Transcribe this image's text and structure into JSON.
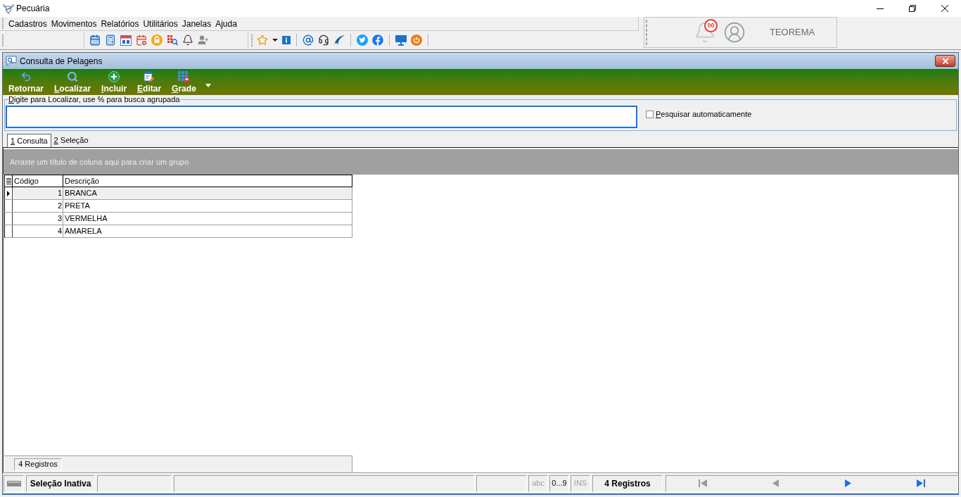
{
  "app": {
    "title": "Pecuária"
  },
  "menu": [
    "Cadastros",
    "Movimentos",
    "Relatórios",
    "Utilitários",
    "Janelas",
    "Ajuda"
  ],
  "user_panel": {
    "notification_count": "00",
    "user": "TEOREMA"
  },
  "form": {
    "title": "Consulta de Pelagens"
  },
  "actions": [
    {
      "label": "Retornar",
      "kind": "back",
      "mnemonic": false
    },
    {
      "label": "Localizar",
      "kind": "find",
      "mnemonic": true
    },
    {
      "label": "Incluir",
      "kind": "add",
      "mnemonic": true
    },
    {
      "label": "Editar",
      "kind": "edit",
      "mnemonic": true
    },
    {
      "label": "Grade",
      "kind": "grid",
      "mnemonic": true
    }
  ],
  "search": {
    "legend": "Digite para Localizar, use % para busca agrupada",
    "legend_mnemonic": true,
    "auto_search": {
      "label": "Pesquisar automaticamente",
      "checked": false,
      "mnemonic": true
    }
  },
  "tabs": [
    {
      "label": "1 Consulta",
      "selected": true,
      "mnemonic": true
    },
    {
      "label": "2 Seleção",
      "selected": false,
      "mnemonic": true
    }
  ],
  "group_panel": {
    "hint": "Arraste um título de coluna aqui para criar um grupo"
  },
  "grid": {
    "columns": [
      "Código",
      "Descrição"
    ],
    "rows": [
      {
        "cells": [
          "1",
          "BRANCA"
        ],
        "selected": true
      },
      {
        "cells": [
          "2",
          "PRETA"
        ],
        "selected": false
      },
      {
        "cells": [
          "3",
          "VERMELHA"
        ],
        "selected": false
      },
      {
        "cells": [
          "4",
          "AMARELA"
        ],
        "selected": false
      }
    ]
  },
  "grid_footer": {
    "count": "4 Registros"
  },
  "status_bar": {
    "selection": "Seleção Inativa",
    "indicators": [
      {
        "label": "abc",
        "active": false
      },
      {
        "label": "0...9",
        "active": true
      },
      {
        "label": "INS",
        "active": false
      }
    ],
    "records": "4 Registros",
    "navigation": [
      {
        "kind": "first",
        "disabled": true
      },
      {
        "kind": "previous",
        "disabled": true
      },
      {
        "kind": "next",
        "disabled": false
      },
      {
        "kind": "last",
        "disabled": false
      }
    ]
  }
}
